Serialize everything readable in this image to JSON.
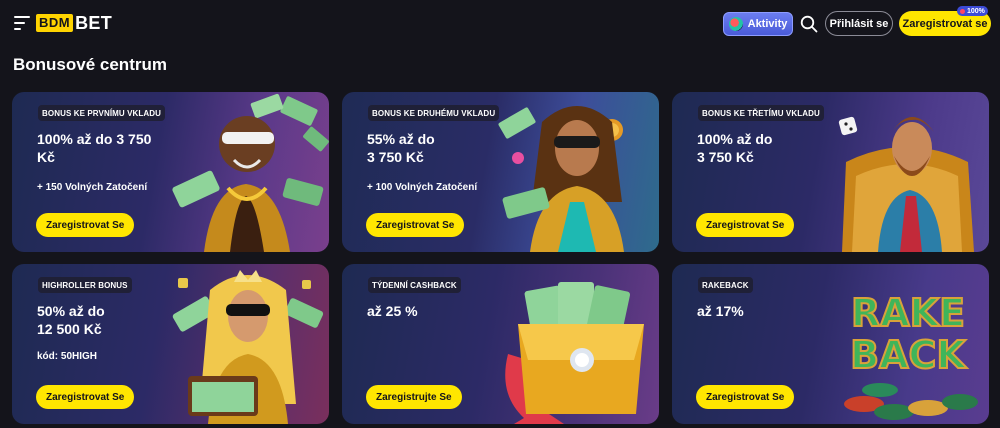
{
  "header": {
    "logo_box": "BDM",
    "logo_text": "BET",
    "aktivity_label": "Aktivity",
    "login_label": "Přihlásit se",
    "register_label": "Zaregistrovat se",
    "badge_label": "100%"
  },
  "page": {
    "title": "Bonusové centrum"
  },
  "cards": [
    {
      "tag": "BONUS KE PRVNÍMU VKLADU",
      "amount": "100% až do 3 750\nKč",
      "extra": "+ 150 Volných Zatočení",
      "cta": "Zaregistrovat Se"
    },
    {
      "tag": "BONUS KE DRUHÉMU VKLADU",
      "amount": "55% až do\n3 750 Kč",
      "extra": "+ 100 Volných Zatočení",
      "cta": "Zaregistrovat Se"
    },
    {
      "tag": "BONUS KE TŘETÍMU VKLADU",
      "amount": "100% až do\n3 750 Kč",
      "extra": "",
      "cta": "Zaregistrovat Se"
    },
    {
      "tag": "HIGHROLLER BONUS",
      "amount": "50% až do\n12 500 Kč",
      "extra": "kód: 50HIGH",
      "cta": "Zaregistrovat Se"
    },
    {
      "tag": "TÝDENNÍ CASHBACK",
      "amount": "až 25 %",
      "extra": "",
      "cta": "Zaregistrujte Se"
    },
    {
      "tag": "RAKEBACK",
      "amount": "až 17%",
      "extra": "",
      "cta": "Zaregistrovat Se"
    }
  ],
  "art_text": {
    "rake": "RAKE",
    "back": "BACK"
  },
  "colors": {
    "accent": "#ffe600",
    "background": "#14141b",
    "aktivity": "#5a6ae0"
  }
}
